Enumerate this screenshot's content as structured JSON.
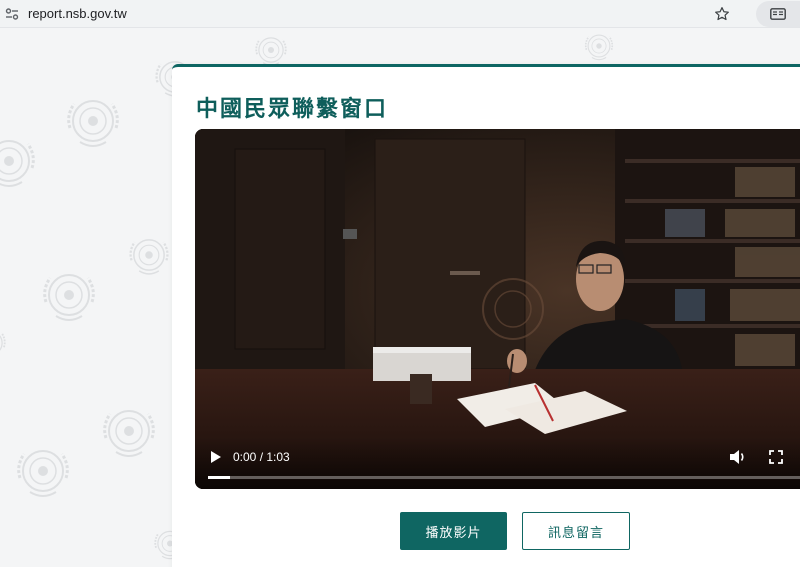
{
  "browser": {
    "url": "report.nsb.gov.tw",
    "icons": {
      "site_info": "site-info-icon",
      "bookmark": "star-icon",
      "extension": "reader-mode-icon"
    }
  },
  "page": {
    "title": "中國民眾聯繫窗口",
    "accent_color": "#0e6663"
  },
  "video": {
    "current_time": "0:00",
    "duration": "1:03",
    "time_display": "0:00 / 1:03",
    "progress_fraction": 0.035,
    "icons": {
      "play": "play-icon",
      "volume": "volume-icon",
      "fullscreen": "fullscreen-icon"
    }
  },
  "actions": {
    "play_video_label": "播放影片",
    "message_label": "訊息留言"
  }
}
